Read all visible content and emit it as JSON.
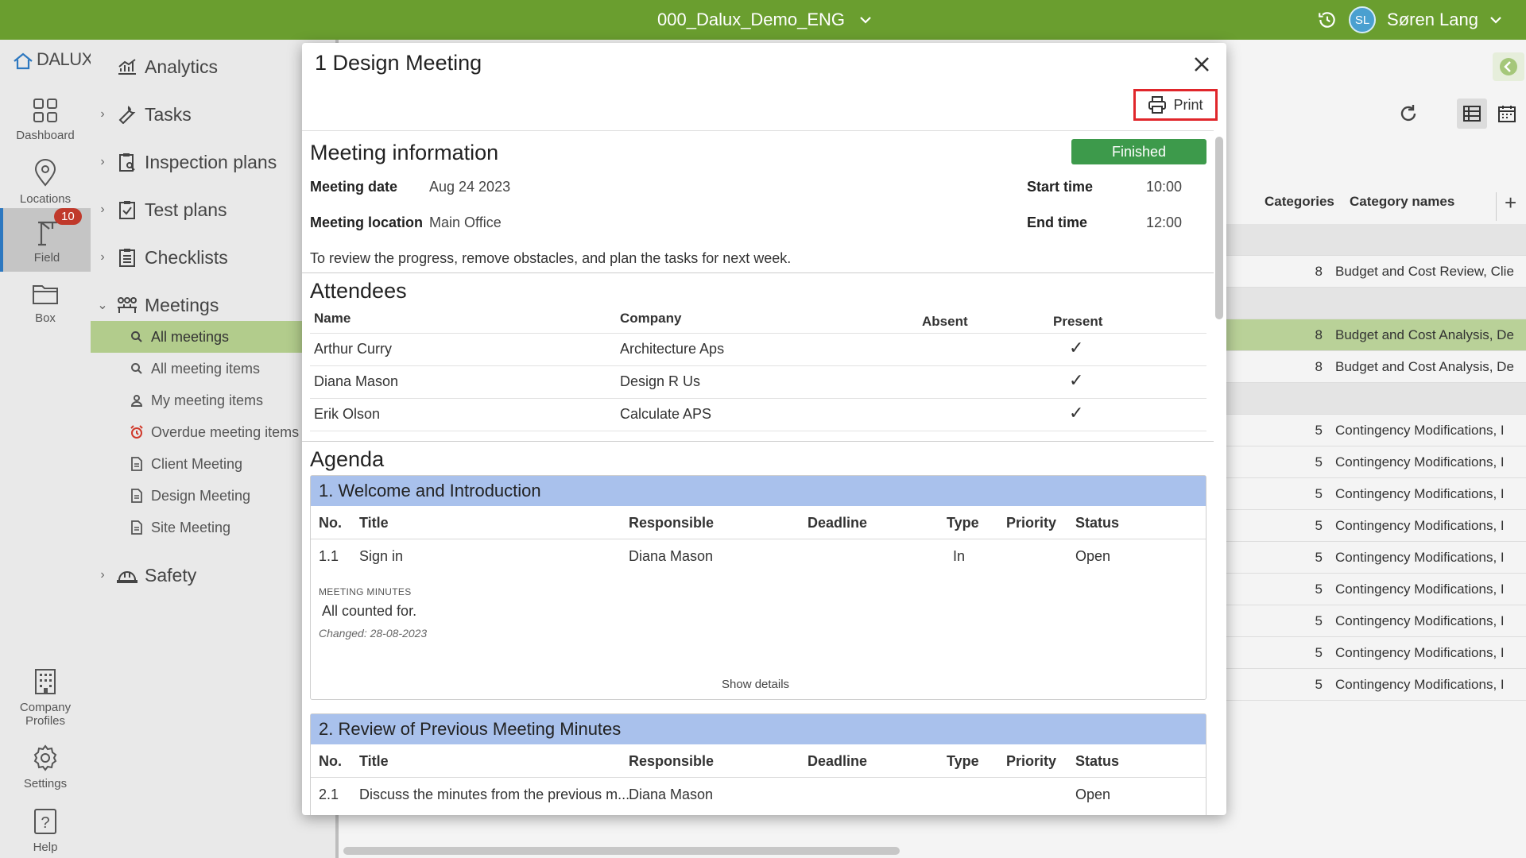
{
  "topbar": {
    "project": "000_Dalux_Demo_ENG",
    "user_initials": "SL",
    "user_name": "Søren Lang"
  },
  "rail": {
    "logo": "DALUX",
    "items": [
      {
        "label": "Dashboard"
      },
      {
        "label": "Locations"
      },
      {
        "label": "Field",
        "badge": "10"
      },
      {
        "label": "Box"
      },
      {
        "label": "Company Profiles"
      },
      {
        "label": "Settings"
      },
      {
        "label": "Help"
      }
    ]
  },
  "nav": {
    "items": [
      "Analytics",
      "Tasks",
      "Inspection plans",
      "Test plans",
      "Checklists",
      "Meetings",
      "Safety"
    ],
    "meeting_subitems": [
      "All meetings",
      "All meeting items",
      "My meeting items",
      "Overdue meeting items",
      "Client Meeting",
      "Design Meeting",
      "Site Meeting"
    ]
  },
  "background_table": {
    "headers": [
      "Categories",
      "Category names"
    ],
    "rows": [
      {
        "num": "8",
        "name": "Budget and Cost Review, Clie"
      },
      {
        "num": "8",
        "name": "Budget and Cost Analysis, De"
      },
      {
        "num": "8",
        "name": "Budget and Cost Analysis, De"
      },
      {
        "num": "5",
        "name": "Contingency Modifications, I"
      },
      {
        "num": "5",
        "name": "Contingency Modifications, I"
      },
      {
        "num": "5",
        "name": "Contingency Modifications, I"
      },
      {
        "num": "5",
        "name": "Contingency Modifications, I"
      },
      {
        "num": "5",
        "name": "Contingency Modifications, I"
      },
      {
        "num": "5",
        "name": "Contingency Modifications, I"
      },
      {
        "num": "5",
        "name": "Contingency Modifications, I"
      },
      {
        "num": "5",
        "name": "Contingency Modifications, I"
      },
      {
        "num": "5",
        "name": "Contingency Modifications, I"
      }
    ]
  },
  "modal": {
    "title": "1 Design Meeting",
    "print_label": "Print",
    "meeting_info": {
      "heading": "Meeting information",
      "status": "Finished",
      "meeting_date_label": "Meeting date",
      "meeting_date": "Aug 24 2023",
      "location_label": "Meeting location",
      "location": "Main Office",
      "start_label": "Start time",
      "start": "10:00",
      "end_label": "End time",
      "end": "12:00",
      "description": "To review the progress, remove obstacles, and plan the tasks for next week."
    },
    "attendees": {
      "heading": "Attendees",
      "col_name": "Name",
      "col_company": "Company",
      "col_absent": "Absent",
      "col_present": "Present",
      "rows": [
        {
          "name": "Arthur Curry",
          "company": "Architecture Aps",
          "present": "✓"
        },
        {
          "name": "Diana Mason",
          "company": "Design R Us",
          "present": "✓"
        },
        {
          "name": "Erik Olson",
          "company": "Calculate APS",
          "present": "✓"
        }
      ]
    },
    "agenda": {
      "heading": "Agenda",
      "columns": [
        "No.",
        "Title",
        "Responsible",
        "Deadline",
        "Type",
        "Priority",
        "Status"
      ],
      "sections": [
        {
          "title": "1. Welcome and Introduction",
          "item": {
            "no": "1.1",
            "title": "Sign in",
            "responsible": "Diana Mason",
            "type": "In",
            "status": "Open"
          },
          "minutes_label": "MEETING MINUTES",
          "minutes": "All counted for.",
          "changed": "Changed: 28-08-2023",
          "show_details": "Show details"
        },
        {
          "title": "2. Review of Previous Meeting Minutes",
          "item": {
            "no": "2.1",
            "title": "Discuss the minutes from the previous m...",
            "responsible": "Diana Mason",
            "type": "",
            "status": "Open"
          }
        }
      ]
    }
  }
}
